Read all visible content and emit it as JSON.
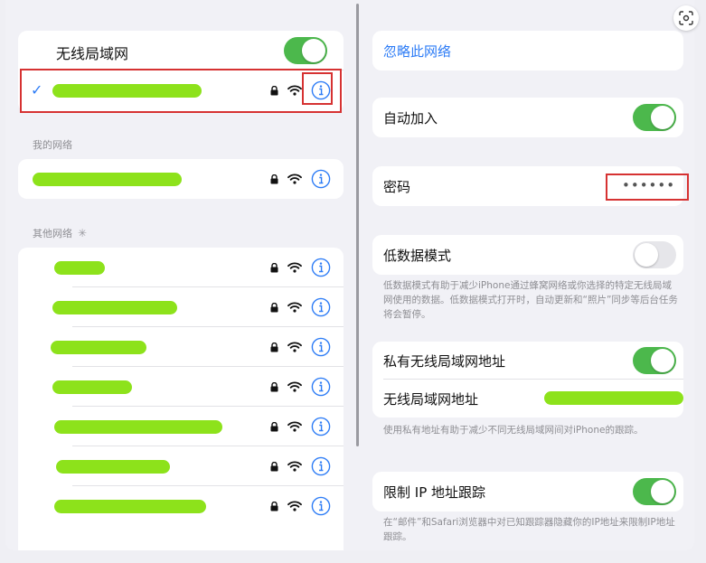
{
  "left": {
    "wlan_label": "无线局域网",
    "my_networks_title": "我的网络",
    "other_networks_title": "其他网络",
    "spinner_icon": "loading-spinner-icon",
    "other_rows": 7
  },
  "right": {
    "forget_network": "忽略此网络",
    "auto_join": "自动加入",
    "password_label": "密码",
    "password_value": "••••••",
    "low_data_label": "低数据模式",
    "low_data_desc": "低数据模式有助于减少iPhone通过蜂窝网络或你选择的特定无线局域网使用的数据。低数据模式打开时，自动更新和“照片”同步等后台任务将会暂停。",
    "private_address_label": "私有无线局域网地址",
    "wlan_address_label": "无线局域网地址",
    "private_address_desc": "使用私有地址有助于减少不同无线局域网间对iPhone的跟踪。",
    "limit_ip_label": "限制 IP 地址跟踪",
    "limit_ip_desc": "在“邮件”和Safari浏览器中对已知跟踪器隐藏你的IP地址来限制IP地址跟踪。"
  },
  "colors": {
    "accent": "#2d7cf6",
    "toggle_on": "#4cb84c",
    "highlight": "#d63232",
    "redaction": "#8de21b"
  }
}
